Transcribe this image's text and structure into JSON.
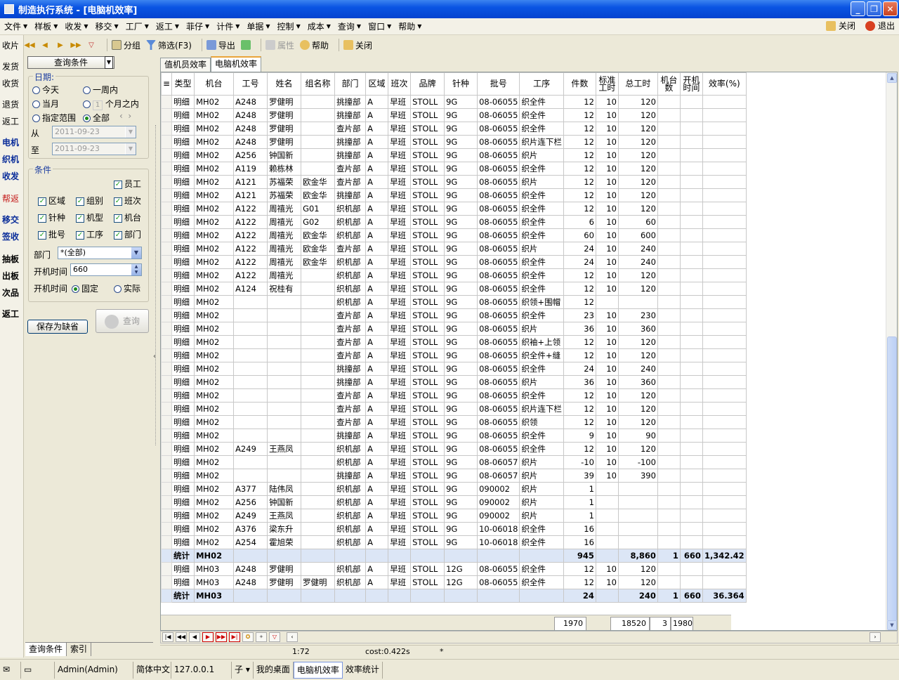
{
  "window": {
    "title": "制造执行系统 - [电脑机效率]"
  },
  "menu": [
    "文件",
    "样板",
    "收发",
    "移交",
    "工厂",
    "返工",
    "菲仔",
    "计件",
    "单据",
    "控制",
    "成本",
    "查询",
    "窗口",
    "帮助"
  ],
  "menu_right": {
    "close": "关闭",
    "exit": "退出"
  },
  "left_nav": [
    {
      "label": "收片",
      "style": ""
    },
    {
      "label": "发货",
      "style": ""
    },
    {
      "label": "收货",
      "style": ""
    },
    {
      "label": "退货",
      "style": ""
    },
    {
      "label": "返工",
      "style": ""
    },
    {
      "label": "电机",
      "style": "blue"
    },
    {
      "label": "织机",
      "style": "blue"
    },
    {
      "label": "收发",
      "style": "blue"
    },
    {
      "label": "帮返",
      "style": "red"
    },
    {
      "label": "移交",
      "style": "blue"
    },
    {
      "label": "签收",
      "style": "blue"
    },
    {
      "label": "抽板",
      "style": "bold"
    },
    {
      "label": "出板",
      "style": "bold"
    },
    {
      "label": "次品",
      "style": "bold"
    },
    {
      "label": "返工",
      "style": "bold"
    }
  ],
  "toolbar": {
    "group": "分组",
    "filter": "筛选(F3)",
    "export": "导出",
    "properties": "属性",
    "help": "帮助",
    "close": "关闭"
  },
  "query": {
    "button": "查询条件",
    "date_title": "日期:",
    "today": "今天",
    "week": "一周内",
    "month": "当月",
    "months_num": "1",
    "months_suffix": "个月之内",
    "range": "指定范围",
    "all": "全部",
    "from_label": "从",
    "to_label": "至",
    "from": "2011-09-23",
    "to": "2011-09-23",
    "cond_title": "条件",
    "c_employee": "员工",
    "c_area": "区域",
    "c_group": "组别",
    "c_shift": "班次",
    "c_needle": "针种",
    "c_machinetype": "机型",
    "c_machine": "机台",
    "c_batch": "批号",
    "c_process": "工序",
    "c_dept": "部门",
    "dept_label": "部门",
    "dept_value": "*(全部)",
    "ontime_label": "开机时间",
    "ontime_value": "660",
    "ontime2_label": "开机时间",
    "fixed": "固定",
    "actual": "实际",
    "save_default": "保存为缺省",
    "search": "查询"
  },
  "left_bottom_tabs": [
    "查询条件",
    "索引"
  ],
  "tabs": [
    "值机员效率",
    "电脑机效率"
  ],
  "grid": {
    "headers": [
      "类型",
      "机台",
      "工号",
      "姓名",
      "组名称",
      "部门",
      "区域",
      "班次",
      "品牌",
      "针种",
      "批号",
      "工序",
      "件数",
      "标准\n工时",
      "总工时",
      "机台\n数",
      "开机\n时间",
      "效率(%)"
    ],
    "rows": [
      [
        "明细",
        "MH02",
        "A248",
        "罗健明",
        "",
        "挑撞部",
        "A",
        "早班",
        "STOLL",
        "9G",
        "08-06055",
        "织全件",
        "12",
        "10",
        "120",
        "",
        "",
        ""
      ],
      [
        "明细",
        "MH02",
        "A248",
        "罗健明",
        "",
        "挑撞部",
        "A",
        "早班",
        "STOLL",
        "9G",
        "08-06055",
        "织全件",
        "12",
        "10",
        "120",
        "",
        "",
        ""
      ],
      [
        "明细",
        "MH02",
        "A248",
        "罗健明",
        "",
        "查片部",
        "A",
        "早班",
        "STOLL",
        "9G",
        "08-06055",
        "织全件",
        "12",
        "10",
        "120",
        "",
        "",
        ""
      ],
      [
        "明细",
        "MH02",
        "A248",
        "罗健明",
        "",
        "挑撞部",
        "A",
        "早班",
        "STOLL",
        "9G",
        "08-06055",
        "织片连下栏",
        "12",
        "10",
        "120",
        "",
        "",
        ""
      ],
      [
        "明细",
        "MH02",
        "A256",
        "钟国新",
        "",
        "挑撞部",
        "A",
        "早班",
        "STOLL",
        "9G",
        "08-06055",
        "织片",
        "12",
        "10",
        "120",
        "",
        "",
        ""
      ],
      [
        "明细",
        "MH02",
        "A119",
        "赖栋林",
        "",
        "查片部",
        "A",
        "早班",
        "STOLL",
        "9G",
        "08-06055",
        "织全件",
        "12",
        "10",
        "120",
        "",
        "",
        ""
      ],
      [
        "明细",
        "MH02",
        "A121",
        "苏福荣",
        "欧金华",
        "查片部",
        "A",
        "早班",
        "STOLL",
        "9G",
        "08-06055",
        "织片",
        "12",
        "10",
        "120",
        "",
        "",
        ""
      ],
      [
        "明细",
        "MH02",
        "A121",
        "苏福荣",
        "欧金华",
        "挑撞部",
        "A",
        "早班",
        "STOLL",
        "9G",
        "08-06055",
        "织全件",
        "12",
        "10",
        "120",
        "",
        "",
        ""
      ],
      [
        "明细",
        "MH02",
        "A122",
        "周禧光",
        "G01",
        "织机部",
        "A",
        "早班",
        "STOLL",
        "9G",
        "08-06055",
        "织全件",
        "12",
        "10",
        "120",
        "",
        "",
        ""
      ],
      [
        "明细",
        "MH02",
        "A122",
        "周禧光",
        "G02",
        "织机部",
        "A",
        "早班",
        "STOLL",
        "9G",
        "08-06055",
        "织全件",
        "6",
        "10",
        "60",
        "",
        "",
        ""
      ],
      [
        "明细",
        "MH02",
        "A122",
        "周禧光",
        "欧金华",
        "织机部",
        "A",
        "早班",
        "STOLL",
        "9G",
        "08-06055",
        "织全件",
        "60",
        "10",
        "600",
        "",
        "",
        ""
      ],
      [
        "明细",
        "MH02",
        "A122",
        "周禧光",
        "欧金华",
        "查片部",
        "A",
        "早班",
        "STOLL",
        "9G",
        "08-06055",
        "织片",
        "24",
        "10",
        "240",
        "",
        "",
        ""
      ],
      [
        "明细",
        "MH02",
        "A122",
        "周禧光",
        "欧金华",
        "织机部",
        "A",
        "早班",
        "STOLL",
        "9G",
        "08-06055",
        "织全件",
        "24",
        "10",
        "240",
        "",
        "",
        ""
      ],
      [
        "明细",
        "MH02",
        "A122",
        "周禧光",
        "",
        "织机部",
        "A",
        "早班",
        "STOLL",
        "9G",
        "08-06055",
        "织全件",
        "12",
        "10",
        "120",
        "",
        "",
        ""
      ],
      [
        "明细",
        "MH02",
        "A124",
        "祝桂有",
        "",
        "织机部",
        "A",
        "早班",
        "STOLL",
        "9G",
        "08-06055",
        "织全件",
        "12",
        "10",
        "120",
        "",
        "",
        ""
      ],
      [
        "明细",
        "MH02",
        "",
        "",
        "",
        "织机部",
        "A",
        "早班",
        "STOLL",
        "9G",
        "08-06055",
        "织领+围帽",
        "12",
        "",
        "",
        "",
        "",
        ""
      ],
      [
        "明细",
        "MH02",
        "",
        "",
        "",
        "查片部",
        "A",
        "早班",
        "STOLL",
        "9G",
        "08-06055",
        "织全件",
        "23",
        "10",
        "230",
        "",
        "",
        ""
      ],
      [
        "明细",
        "MH02",
        "",
        "",
        "",
        "查片部",
        "A",
        "早班",
        "STOLL",
        "9G",
        "08-06055",
        "织片",
        "36",
        "10",
        "360",
        "",
        "",
        ""
      ],
      [
        "明细",
        "MH02",
        "",
        "",
        "",
        "查片部",
        "A",
        "早班",
        "STOLL",
        "9G",
        "08-06055",
        "织袖+上领",
        "12",
        "10",
        "120",
        "",
        "",
        ""
      ],
      [
        "明细",
        "MH02",
        "",
        "",
        "",
        "查片部",
        "A",
        "早班",
        "STOLL",
        "9G",
        "08-06055",
        "织全件+缝",
        "12",
        "10",
        "120",
        "",
        "",
        ""
      ],
      [
        "明细",
        "MH02",
        "",
        "",
        "",
        "挑撞部",
        "A",
        "早班",
        "STOLL",
        "9G",
        "08-06055",
        "织全件",
        "24",
        "10",
        "240",
        "",
        "",
        ""
      ],
      [
        "明细",
        "MH02",
        "",
        "",
        "",
        "挑撞部",
        "A",
        "早班",
        "STOLL",
        "9G",
        "08-06055",
        "织片",
        "36",
        "10",
        "360",
        "",
        "",
        ""
      ],
      [
        "明细",
        "MH02",
        "",
        "",
        "",
        "查片部",
        "A",
        "早班",
        "STOLL",
        "9G",
        "08-06055",
        "织全件",
        "12",
        "10",
        "120",
        "",
        "",
        ""
      ],
      [
        "明细",
        "MH02",
        "",
        "",
        "",
        "查片部",
        "A",
        "早班",
        "STOLL",
        "9G",
        "08-06055",
        "织片连下栏",
        "12",
        "10",
        "120",
        "",
        "",
        ""
      ],
      [
        "明细",
        "MH02",
        "",
        "",
        "",
        "查片部",
        "A",
        "早班",
        "STOLL",
        "9G",
        "08-06055",
        "织领",
        "12",
        "10",
        "120",
        "",
        "",
        ""
      ],
      [
        "明细",
        "MH02",
        "",
        "",
        "",
        "挑撞部",
        "A",
        "早班",
        "STOLL",
        "9G",
        "08-06055",
        "织全件",
        "9",
        "10",
        "90",
        "",
        "",
        ""
      ],
      [
        "明细",
        "MH02",
        "A249",
        "王燕凤",
        "",
        "织机部",
        "A",
        "早班",
        "STOLL",
        "9G",
        "08-06055",
        "织全件",
        "12",
        "10",
        "120",
        "",
        "",
        ""
      ],
      [
        "明细",
        "MH02",
        "",
        "",
        "",
        "织机部",
        "A",
        "早班",
        "STOLL",
        "9G",
        "08-06057",
        "织片",
        "-10",
        "10",
        "-100",
        "",
        "",
        ""
      ],
      [
        "明细",
        "MH02",
        "",
        "",
        "",
        "挑撞部",
        "A",
        "早班",
        "STOLL",
        "9G",
        "08-06057",
        "织片",
        "39",
        "10",
        "390",
        "",
        "",
        ""
      ],
      [
        "明细",
        "MH02",
        "A377",
        "陆伟凤",
        "",
        "织机部",
        "A",
        "早班",
        "STOLL",
        "9G",
        "090002",
        "织片",
        "1",
        "",
        "",
        "",
        "",
        ""
      ],
      [
        "明细",
        "MH02",
        "A256",
        "钟国新",
        "",
        "织机部",
        "A",
        "早班",
        "STOLL",
        "9G",
        "090002",
        "织片",
        "1",
        "",
        "",
        "",
        "",
        ""
      ],
      [
        "明细",
        "MH02",
        "A249",
        "王燕凤",
        "",
        "织机部",
        "A",
        "早班",
        "STOLL",
        "9G",
        "090002",
        "织片",
        "1",
        "",
        "",
        "",
        "",
        ""
      ],
      [
        "明细",
        "MH02",
        "A376",
        "梁东升",
        "",
        "织机部",
        "A",
        "早班",
        "STOLL",
        "9G",
        "10-06018",
        "织全件",
        "16",
        "",
        "",
        "",
        "",
        ""
      ],
      [
        "明细",
        "MH02",
        "A254",
        "霍旭荣",
        "",
        "织机部",
        "A",
        "早班",
        "STOLL",
        "9G",
        "10-06018",
        "织全件",
        "16",
        "",
        "",
        "",
        "",
        ""
      ],
      [
        "统计",
        "MH02",
        "",
        "",
        "",
        "",
        "",
        "",
        "",
        "",
        "",
        "",
        "945",
        "",
        "8,860",
        "1",
        "660",
        "1,342.42"
      ],
      [
        "明细",
        "MH03",
        "A248",
        "罗健明",
        "",
        "织机部",
        "A",
        "早班",
        "STOLL",
        "12G",
        "08-06055",
        "织全件",
        "12",
        "10",
        "120",
        "",
        "",
        ""
      ],
      [
        "明细",
        "MH03",
        "A248",
        "罗健明",
        "罗健明",
        "织机部",
        "A",
        "早班",
        "STOLL",
        "12G",
        "08-06055",
        "织全件",
        "12",
        "10",
        "120",
        "",
        "",
        ""
      ],
      [
        "统计",
        "MH03",
        "",
        "",
        "",
        "",
        "",
        "",
        "",
        "",
        "",
        "",
        "24",
        "",
        "240",
        "1",
        "660",
        "36.364"
      ]
    ],
    "footer": {
      "qty": "1970",
      "total_hours": "18520",
      "machines": "3",
      "ontime": "1980"
    }
  },
  "status": {
    "position": "1:72",
    "cost": "cost:0.422s",
    "flag": "*"
  },
  "taskbar": {
    "user": "Admin(Admin)",
    "lang": "简体中文",
    "ip": "127.0.0.1",
    "child": "子",
    "desktop": "我的桌面",
    "active": "电脑机效率",
    "other": "效率统计"
  },
  "colors": {
    "titlebar": "#0a54e3",
    "summary_row": "#dce6f6",
    "accent_tab": "#e9a43a",
    "nav_blue": "#0a2d9a",
    "nav_red": "#c41a1a"
  }
}
